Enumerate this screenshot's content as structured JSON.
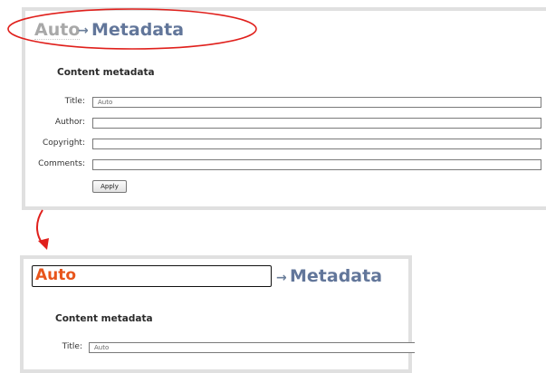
{
  "top_panel": {
    "breadcrumb": {
      "auto": "Auto",
      "arrow": "→",
      "metadata": "Metadata"
    },
    "section_title": "Content metadata",
    "fields": {
      "title": {
        "label": "Title:",
        "value": "Auto"
      },
      "author": {
        "label": "Author:",
        "value": ""
      },
      "copyright": {
        "label": "Copyright:",
        "value": ""
      },
      "comments": {
        "label": "Comments:",
        "value": ""
      }
    },
    "apply_label": "Apply"
  },
  "bottom_panel": {
    "breadcrumb": {
      "auto": "Auto",
      "arrow": "→",
      "metadata": "Metadata"
    },
    "section_title": "Content metadata",
    "fields": {
      "title": {
        "label": "Title:",
        "value": "Auto"
      }
    }
  },
  "colors": {
    "highlight_red": "#e0201c",
    "editing_orange": "#e8551b",
    "breadcrumb_blue": "#62769a",
    "breadcrumb_gray": "#a8a8a8",
    "panel_border": "#e0e0e0"
  }
}
